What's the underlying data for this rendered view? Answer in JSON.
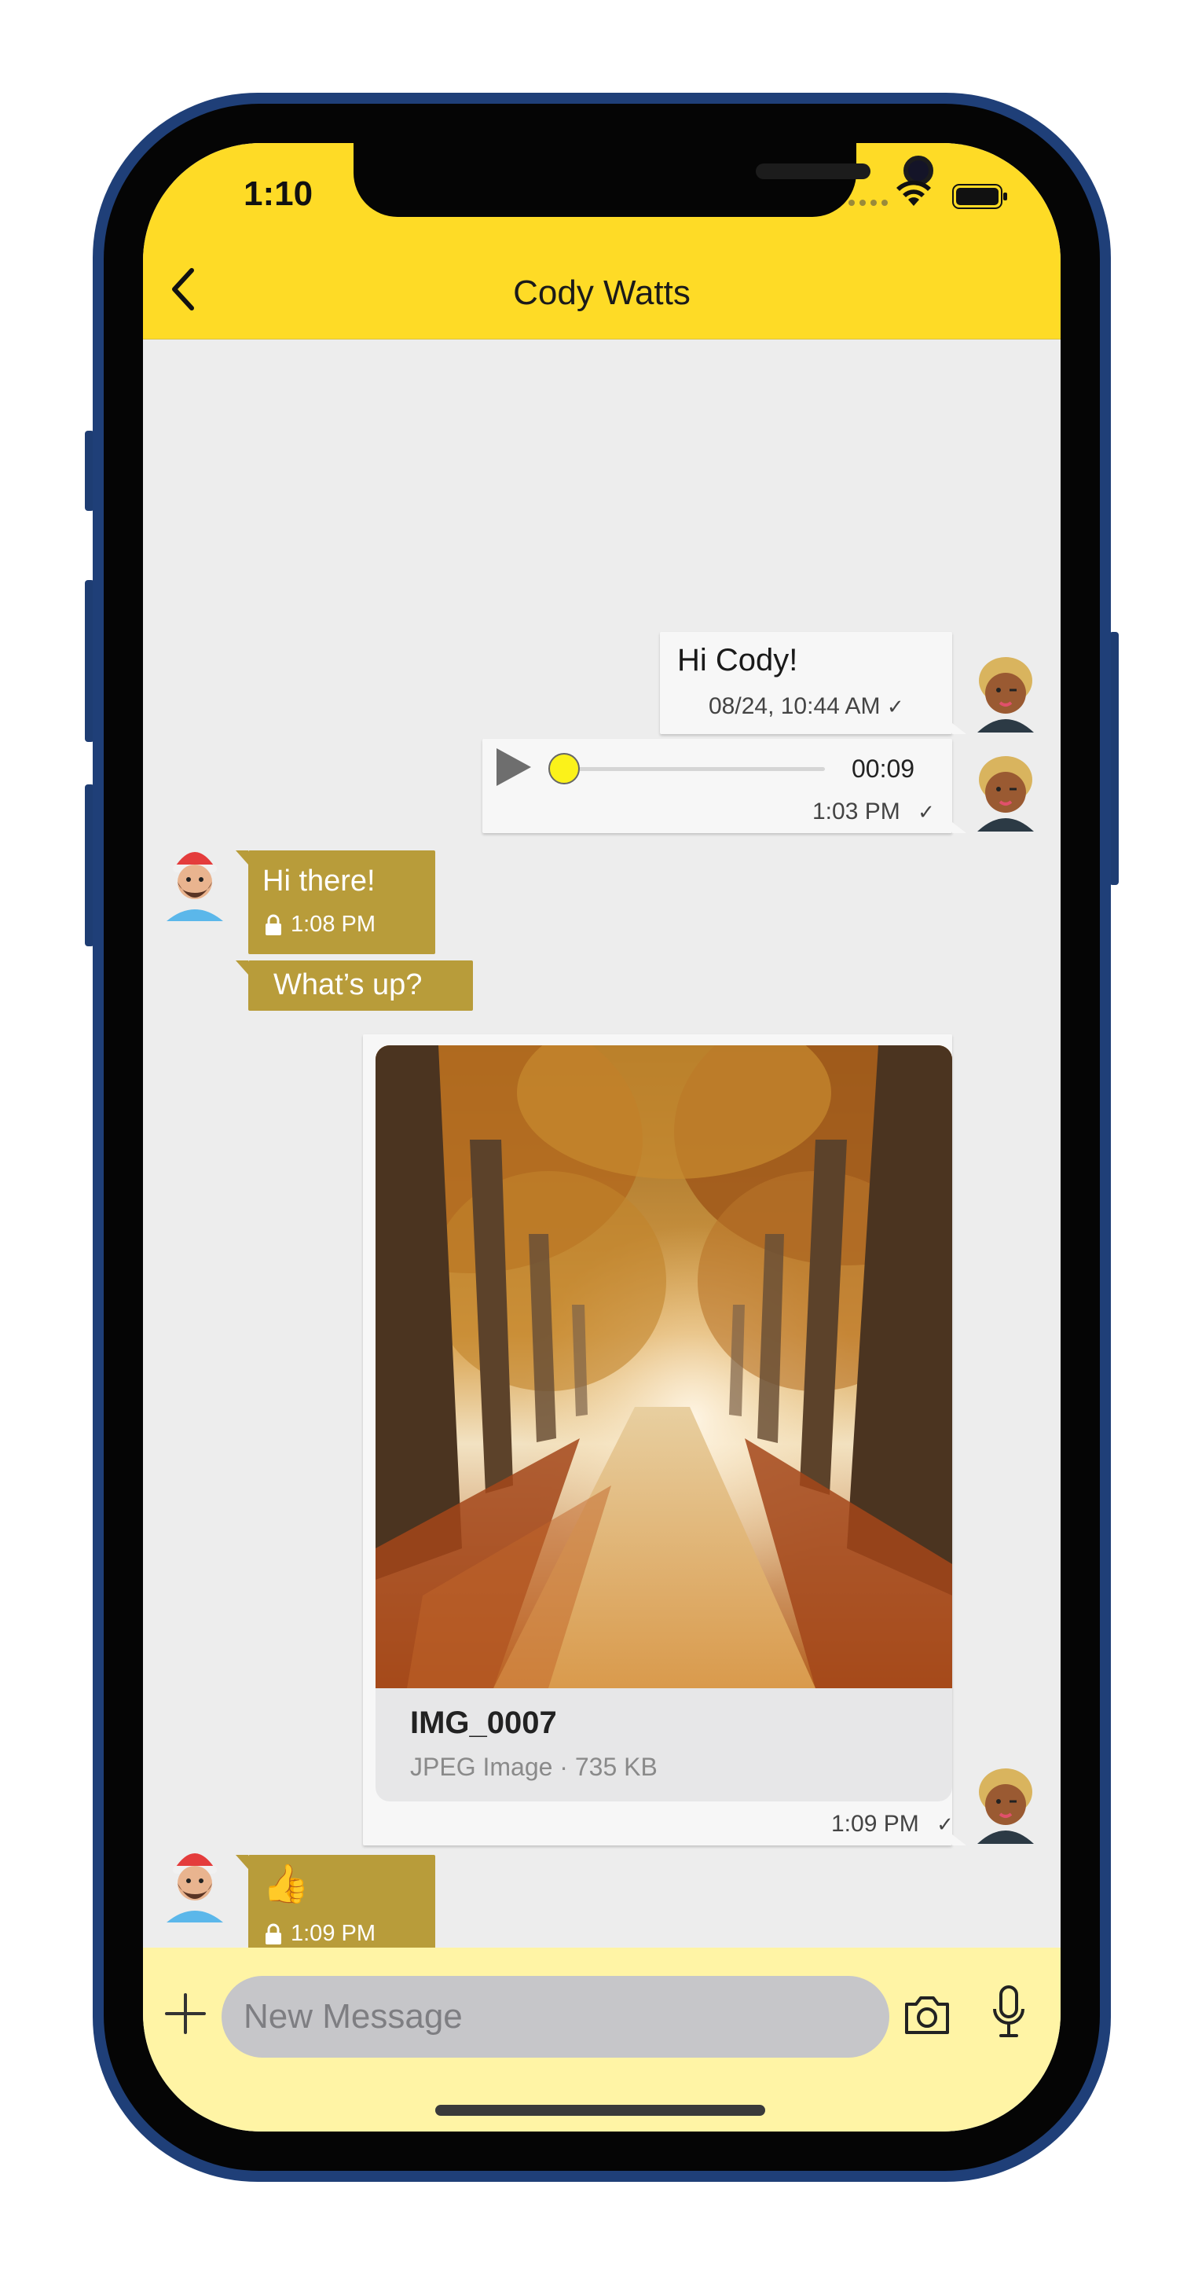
{
  "status_bar": {
    "time": "1:10"
  },
  "header": {
    "title": "Cody Watts"
  },
  "messages": {
    "m1": {
      "text": "Hi Cody!",
      "time": "08/24, 10:44 AM",
      "check": "✓"
    },
    "m2": {
      "duration": "00:09",
      "time": "1:03 PM",
      "check": "✓",
      "progress": 0.0
    },
    "m3": {
      "text": "Hi there!",
      "time": "1:08 PM"
    },
    "m4": {
      "text": "What’s up?"
    },
    "m5": {
      "file_name": "IMG_0007",
      "file_desc": "JPEG Image · 735 KB",
      "time": "1:09 PM",
      "check": "✓"
    },
    "m6": {
      "text": "👍",
      "time": "1:09 PM"
    }
  },
  "input": {
    "placeholder": "New Message"
  },
  "colors": {
    "header": "#fedb26",
    "incoming_bubble": "#b89c3a",
    "outgoing_bubble": "#f7f7f7",
    "input_bar": "#fff4a5",
    "chat_background": "#ededed"
  },
  "icons": {
    "back": "back-chevron-icon",
    "wifi": "wifi-icon",
    "battery": "battery-icon",
    "play": "play-icon",
    "lock": "lock-icon",
    "plus": "plus-icon",
    "camera": "camera-icon",
    "mic": "microphone-icon"
  }
}
